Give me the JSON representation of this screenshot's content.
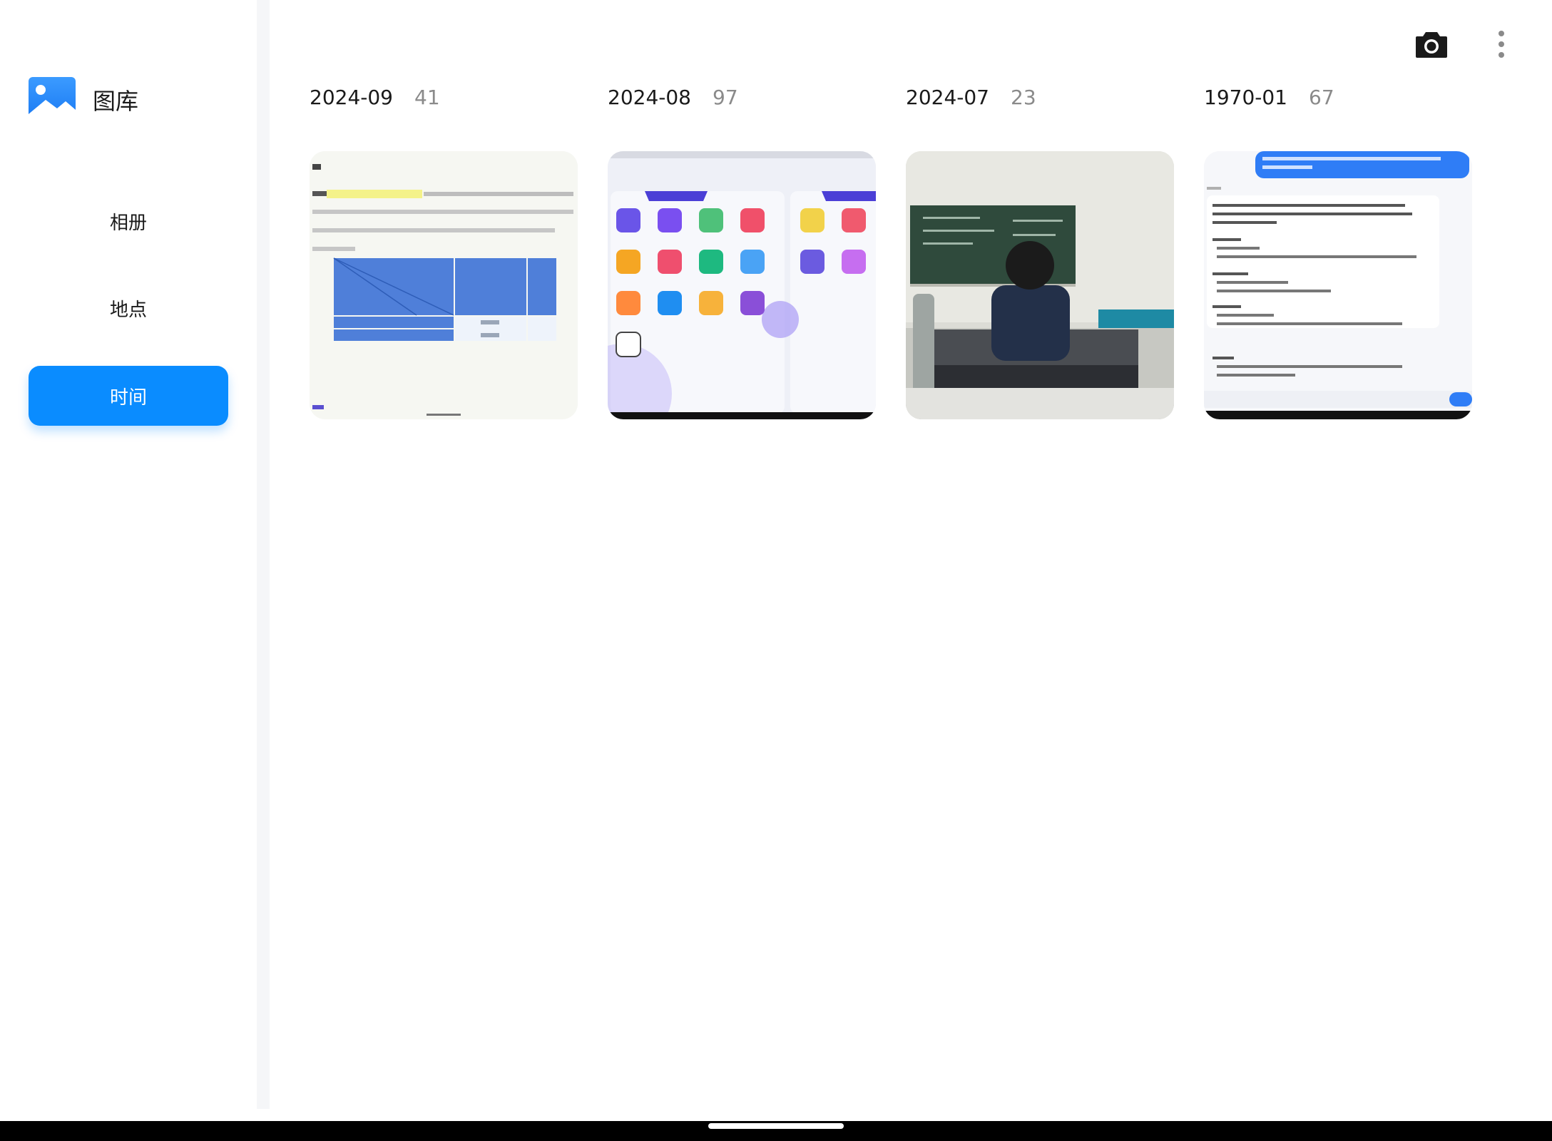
{
  "app": {
    "title": "图库"
  },
  "sidebar": {
    "items": [
      {
        "label": "相册"
      },
      {
        "label": "地点"
      },
      {
        "label": "时间",
        "active": true
      }
    ]
  },
  "toolbar": {
    "camera_icon": "camera-icon",
    "more_icon": "more-vertical-icon"
  },
  "groups": [
    {
      "date": "2024-09",
      "count": "41",
      "thumb": "document-photo"
    },
    {
      "date": "2024-08",
      "count": "97",
      "thumb": "app-drawer-screenshot"
    },
    {
      "date": "2024-07",
      "count": "23",
      "thumb": "classroom-photo"
    },
    {
      "date": "1970-01",
      "count": "67",
      "thumb": "chat-screenshot"
    }
  ],
  "colors": {
    "accent": "#0a8cff",
    "text": "#1a1a1a",
    "count": "#8a8a8a"
  }
}
